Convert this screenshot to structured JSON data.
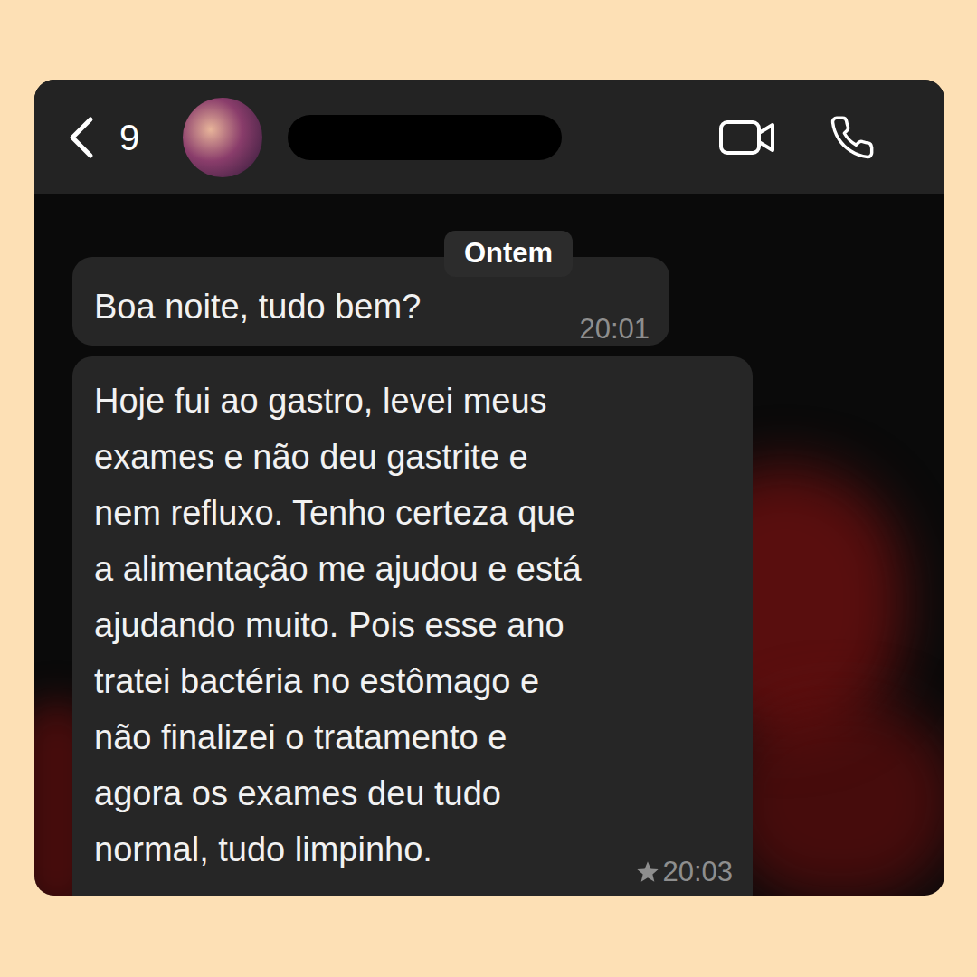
{
  "header": {
    "unread_count": "9"
  },
  "date_label": "Ontem",
  "messages": [
    {
      "lines": [
        "Boa noite, tudo bem?"
      ],
      "time": "20:01",
      "starred": false
    },
    {
      "lines": [
        "Hoje fui ao gastro, levei meus",
        "exames e não deu gastrite e",
        "nem refluxo. Tenho certeza que",
        "a alimentação me ajudou e está",
        "ajudando muito. Pois esse ano",
        "tratei bactéria no estômago e",
        "não finalizei o tratamento e",
        "agora os exames deu tudo",
        "normal, tudo limpinho."
      ],
      "time": "20:03",
      "starred": true
    }
  ]
}
